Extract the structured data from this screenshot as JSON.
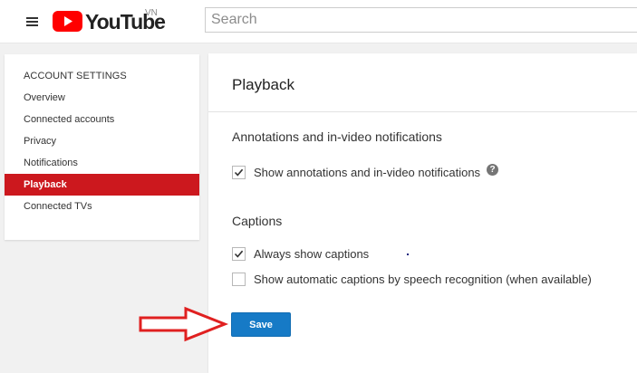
{
  "header": {
    "logo_text": "YouTube",
    "country_code": "VN",
    "search_placeholder": "Search"
  },
  "sidebar": {
    "heading": "ACCOUNT SETTINGS",
    "items": [
      {
        "label": "Overview",
        "active": false
      },
      {
        "label": "Connected accounts",
        "active": false
      },
      {
        "label": "Privacy",
        "active": false
      },
      {
        "label": "Notifications",
        "active": false
      },
      {
        "label": "Playback",
        "active": true
      },
      {
        "label": "Connected TVs",
        "active": false
      }
    ]
  },
  "main": {
    "title": "Playback",
    "annotations": {
      "heading": "Annotations and in-video notifications",
      "option_label": "Show annotations and in-video notifications",
      "checked": true,
      "help_glyph": "?"
    },
    "captions": {
      "heading": "Captions",
      "options": [
        {
          "label": "Always show captions",
          "checked": true
        },
        {
          "label": "Show automatic captions by speech recognition (when available)",
          "checked": false
        }
      ]
    },
    "save_label": "Save"
  },
  "colors": {
    "brand_red": "#ff0000",
    "active_item_bg": "#cc181e",
    "save_button_bg": "#167ac6",
    "annotation_arrow": "#e02020"
  },
  "icons": {
    "menu": "hamburger-menu-icon",
    "logo_play": "youtube-play-icon",
    "check": "checkmark-icon",
    "help": "help-circle-icon",
    "arrow": "red-arrow-annotation"
  }
}
